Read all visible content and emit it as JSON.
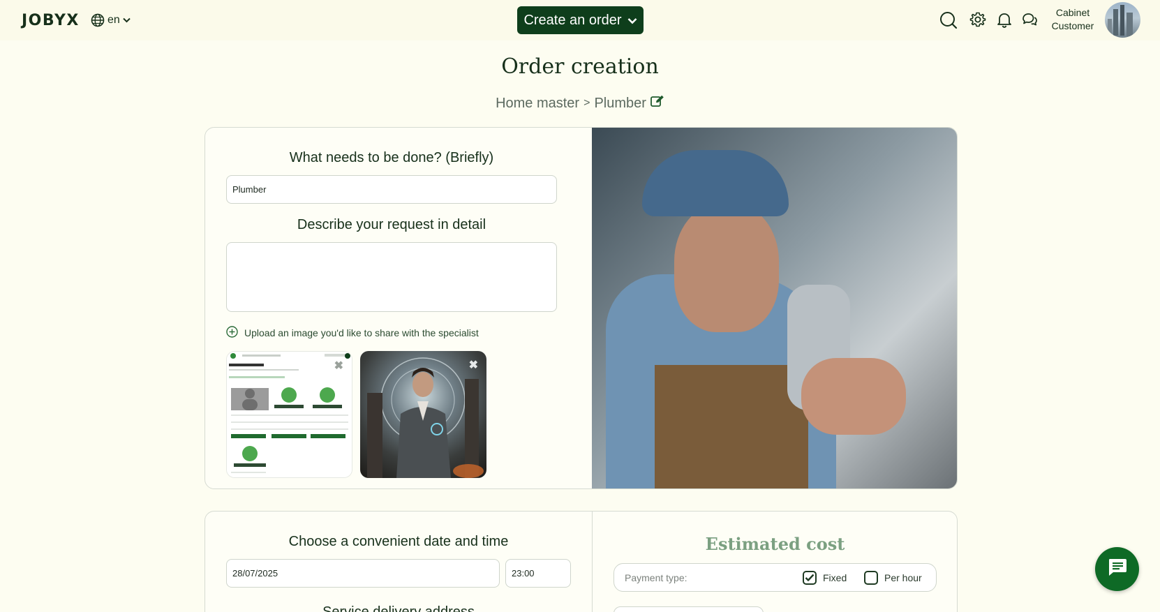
{
  "header": {
    "logo": "JOBYX",
    "lang": "en",
    "create_order_label": "Create an order",
    "icons": [
      "search-icon",
      "gear-icon",
      "bell-icon",
      "chat-icon"
    ],
    "user_name_line1": "Cabinet",
    "user_name_line2": "Customer"
  },
  "page": {
    "title": "Order creation",
    "breadcrumb_category": "Home master",
    "breadcrumb_separator": ">",
    "breadcrumb_item": "Plumber"
  },
  "order_form": {
    "brief_label": "What needs to be done? (Briefly)",
    "brief_value": "Plumber",
    "detail_label": "Describe your request in detail",
    "detail_value": "",
    "upload_label": "Upload an image you'd like to share with the specialist",
    "attachments": [
      {
        "name": "attachment-screenshot",
        "close_glyph": "✖"
      },
      {
        "name": "attachment-portrait",
        "close_glyph": "✖"
      }
    ]
  },
  "schedule": {
    "label": "Choose a convenient date and time",
    "date_value": "28/07/2025",
    "time_value": "23:00",
    "address_label": "Service delivery address"
  },
  "estimate": {
    "title": "Estimated cost",
    "payment_type_label": "Payment type:",
    "options": [
      {
        "label": "Fixed",
        "checked": true
      },
      {
        "label": "Per hour",
        "checked": false
      }
    ]
  },
  "colors": {
    "brand_dark_green": "#0e3e1b",
    "fab_green": "#0e6a26",
    "background": "#fdfdf1",
    "estimate_title": "#7ba081"
  }
}
